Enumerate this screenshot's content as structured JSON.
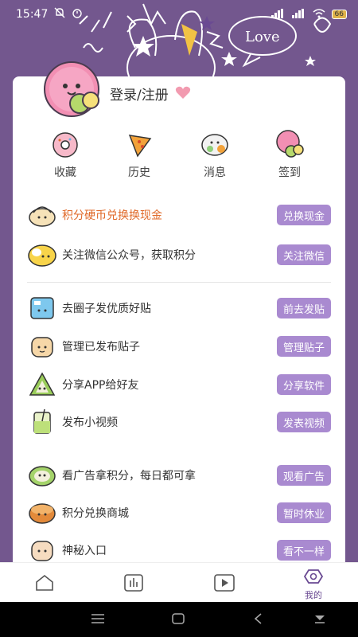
{
  "status_bar": {
    "time": "15:47",
    "battery": "66"
  },
  "header": {
    "bubble_text": "Love"
  },
  "profile": {
    "login_label": "登录/注册"
  },
  "quick_actions": [
    {
      "label": "收藏",
      "icon": "donut-icon"
    },
    {
      "label": "历史",
      "icon": "pizza-icon"
    },
    {
      "label": "消息",
      "icon": "sushi-icon"
    },
    {
      "label": "签到",
      "icon": "mochi-icon"
    }
  ],
  "menu": [
    {
      "label": "积分硬币兑换换现金",
      "button": "兑换现金",
      "icon": "dumpling-icon"
    },
    {
      "label": "关注微信公众号，获取积分",
      "button": "关注微信",
      "icon": "egg-icon"
    },
    {
      "label": "去圈子发优质好贴",
      "button": "前去发贴",
      "icon": "ice-cube-icon"
    },
    {
      "label": "管理已发布贴子",
      "button": "管理贴子",
      "icon": "toast-icon"
    },
    {
      "label": "分享APP给好友",
      "button": "分享软件",
      "icon": "rice-dumpling-icon"
    },
    {
      "label": "发布小视频",
      "button": "发表视频",
      "icon": "drink-icon"
    },
    {
      "label": "看广告拿积分，每日都可拿",
      "button": "观看广告",
      "icon": "roll-cake-icon"
    },
    {
      "label": "积分兑换商城",
      "button": "暂时休业",
      "icon": "cookie-icon"
    },
    {
      "label": "神秘入口",
      "button": "看不一样",
      "icon": "bun-icon"
    }
  ],
  "bottom_nav": {
    "active_label": "我的"
  },
  "colors": {
    "background": "#73578e",
    "accent_button": "#a98ad0",
    "highlight_text": "#e06a2a"
  }
}
